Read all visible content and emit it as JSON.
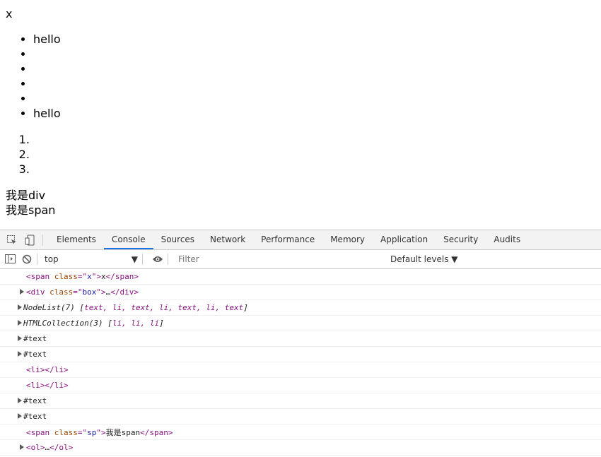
{
  "page": {
    "span_x": "x",
    "ul_items": [
      "hello",
      "",
      "",
      "",
      "",
      "hello"
    ],
    "ol_items": [
      "",
      "",
      ""
    ],
    "div_text": "我是div",
    "span_text": "我是span"
  },
  "devtools": {
    "tabs": [
      "Elements",
      "Console",
      "Sources",
      "Network",
      "Performance",
      "Memory",
      "Application",
      "Security",
      "Audits"
    ],
    "active_tab": "Console",
    "context": "top",
    "filter_placeholder": "Filter",
    "levels_label": "Default levels ▼"
  },
  "console": {
    "r1": {
      "open": "<span ",
      "attr": "class",
      "eq": "=\"",
      "val": "x",
      "close": "\">",
      "text": "x",
      "end": "</span>"
    },
    "r2": {
      "open": "<div ",
      "attr": "class",
      "eq": "=\"",
      "val": "box",
      "close": "\">",
      "text": "…",
      "end": "</div>"
    },
    "r3": {
      "label": "NodeList(7) [",
      "items": "text, li, text, li, text, li, text",
      "end": "]"
    },
    "r4": {
      "label": "HTMLCollection(3) [",
      "items": "li, li, li",
      "end": "]"
    },
    "r5": "#text",
    "r6": "#text",
    "r7": "<li></li>",
    "r8": "<li></li>",
    "r9": "#text",
    "r10": "#text",
    "r11": {
      "open": "<span ",
      "attr": "class",
      "eq": "=\"",
      "val": "sp",
      "close": "\">",
      "text": "我是span",
      "end": "</span>"
    },
    "r12": {
      "open": "<ol>",
      "text": "…",
      "end": "</ol>"
    }
  }
}
